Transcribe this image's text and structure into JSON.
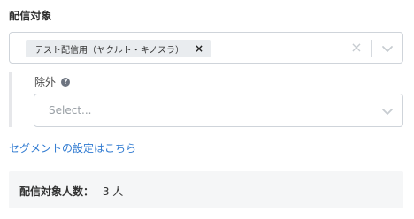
{
  "target": {
    "title": "配信対象",
    "selected_tags": [
      {
        "label": "テスト配信用（ヤクルト・キノスラ）",
        "remove": "×"
      }
    ],
    "clear_glyph": "×"
  },
  "exclude": {
    "label": "除外",
    "help_glyph": "?",
    "placeholder": "Select..."
  },
  "segment_link": "セグメントの設定はこちら",
  "recipients": {
    "label": "配信対象人数：",
    "value": "3 人"
  },
  "colors": {
    "link": "#2f7ad1",
    "border": "#cfd4da",
    "panel": "#f5f6f7",
    "chip": "#e9ecef"
  },
  "icons": {
    "clear": "close-icon",
    "dropdown": "chevron-down-icon",
    "help": "question-circle-icon"
  }
}
